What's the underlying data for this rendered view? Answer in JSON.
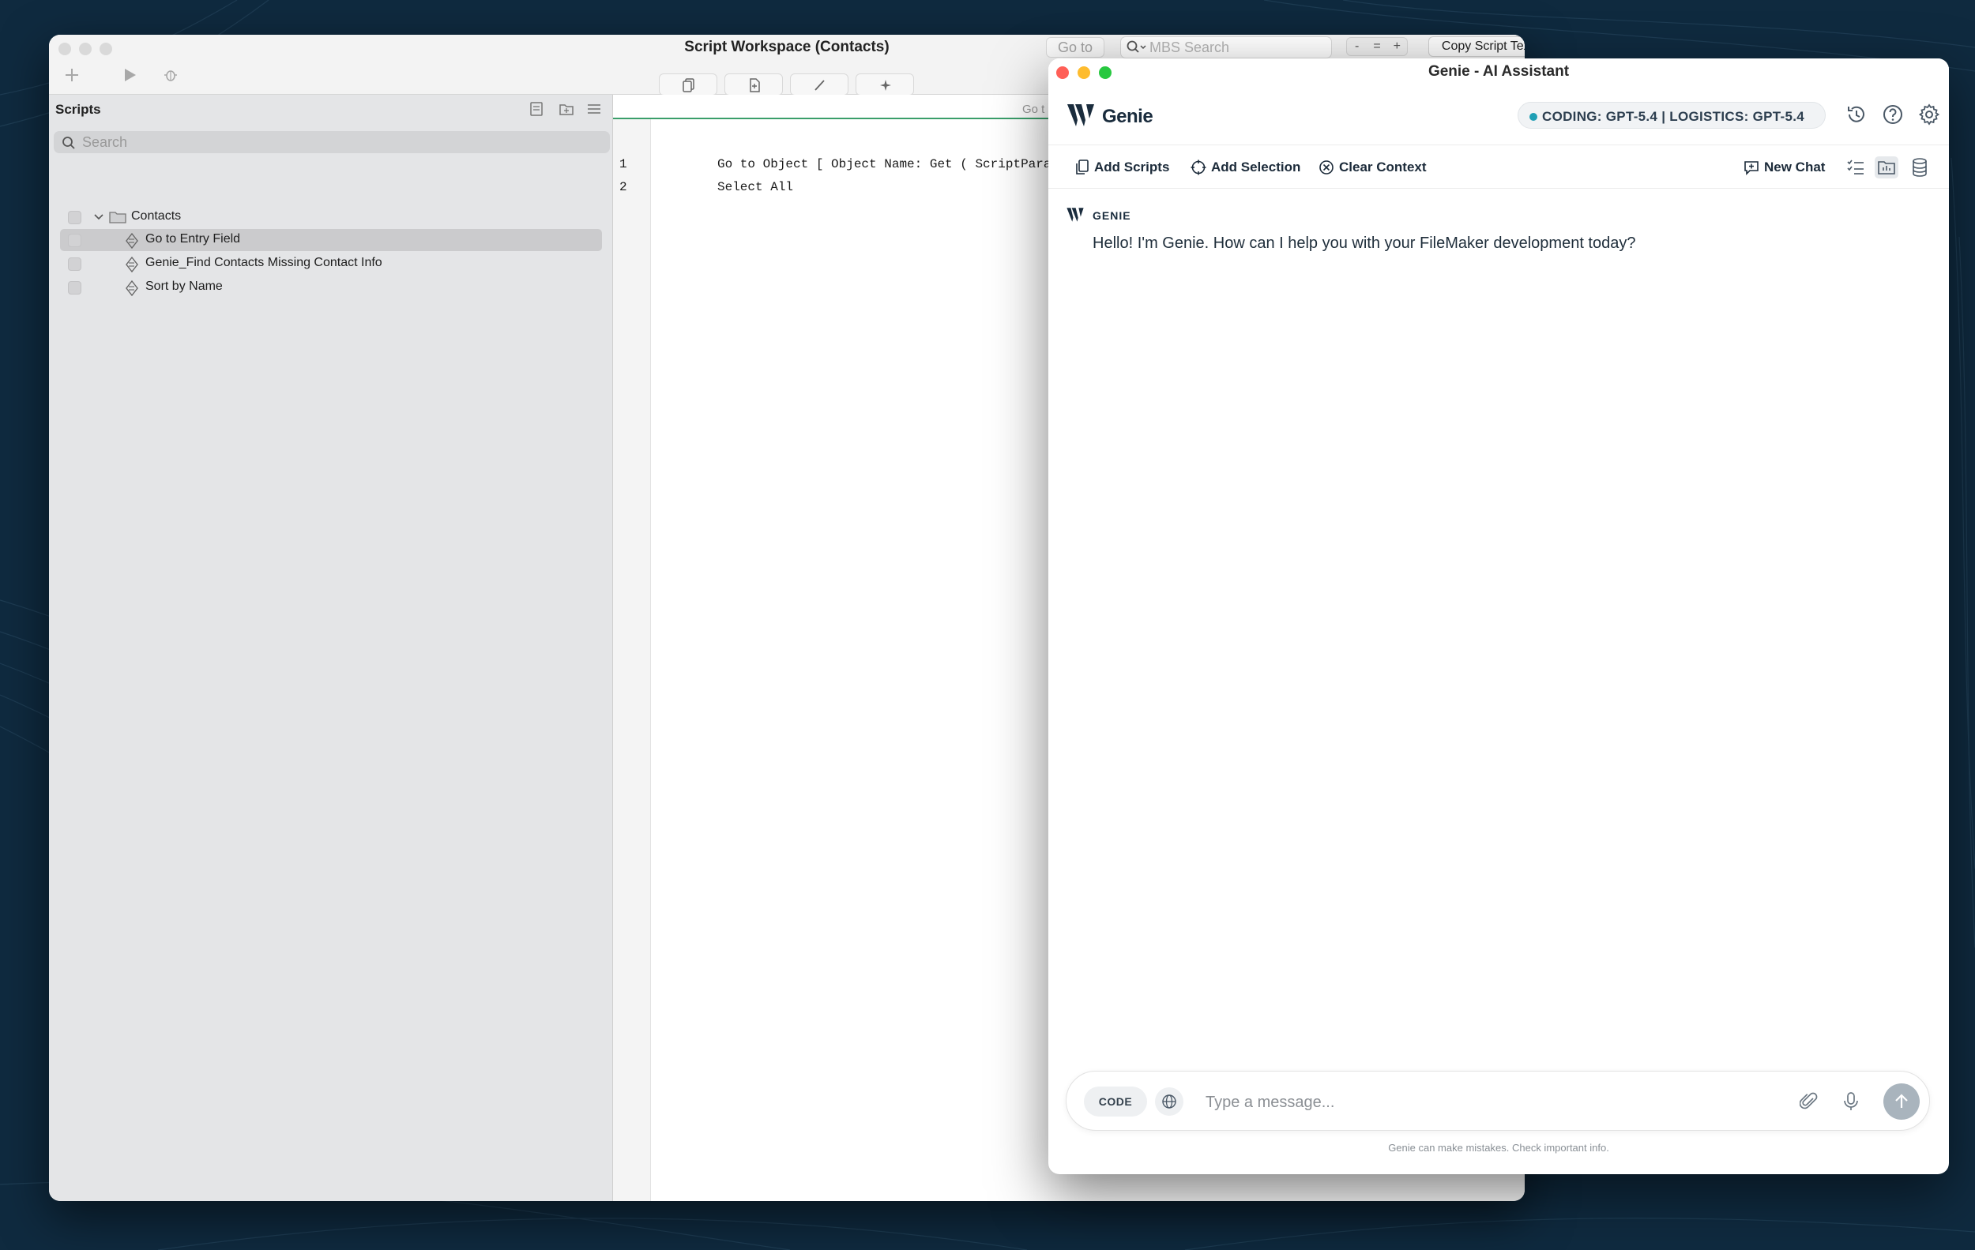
{
  "workspace": {
    "title": "Script Workspace (Contacts)",
    "goto_label": "Go to",
    "mbs_search_placeholder": "MBS Search",
    "zoom": {
      "minus": "-",
      "equal": "=",
      "plus": "+"
    },
    "copy_button": "Copy Script Text",
    "sidebar": {
      "title": "Scripts",
      "search_placeholder": "Search",
      "folder": "Contacts",
      "scripts": [
        {
          "name": "Go to Entry Field",
          "selected": true
        },
        {
          "name": "Genie_Find Contacts Missing Contact Info",
          "selected": false
        },
        {
          "name": "Sort by Name",
          "selected": false
        }
      ]
    },
    "editor": {
      "goto_hint": "Go t",
      "lines": [
        {
          "num": "1",
          "text": "Go to Object [ Object Name: Get ( ScriptParameter ) ]"
        },
        {
          "num": "2",
          "text": "Select All"
        }
      ]
    }
  },
  "genie": {
    "window_title": "Genie - AI Assistant",
    "brand": "Genie",
    "model_badge": "CODING: GPT-5.4 | LOGISTICS: GPT-5.4",
    "toolbar": {
      "add_scripts": "Add Scripts",
      "add_selection": "Add Selection",
      "clear_context": "Clear Context",
      "new_chat": "New Chat"
    },
    "messages": [
      {
        "author": "GENIE",
        "text": "Hello! I'm Genie. How can I help you with your FileMaker development today?"
      }
    ],
    "input": {
      "mode_pill": "CODE",
      "placeholder": "Type a message..."
    },
    "disclaimer": "Genie can make mistakes. Check important info."
  },
  "colors": {
    "desktop": "#0f2a3f",
    "accent": "#1f9fb5",
    "brand_text": "#1a2c3d"
  }
}
